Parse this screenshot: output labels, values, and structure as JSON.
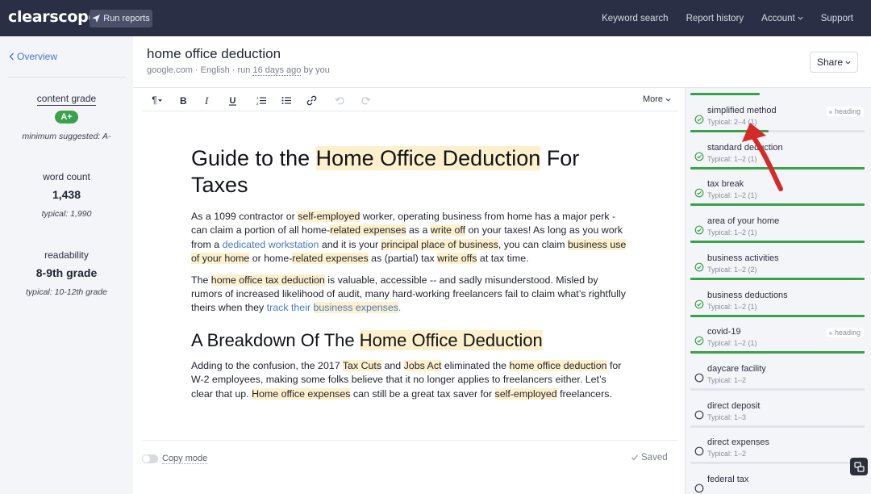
{
  "app": {
    "logo_text": "clearscope",
    "run_reports_label": "Run reports",
    "nav": [
      "Keyword search",
      "Report history",
      "Account",
      "Support"
    ]
  },
  "sidebar": {
    "overview_label": "Overview",
    "content_grade_label": "content grade",
    "content_grade_value": "A+",
    "minimum_suggested": "minimum suggested: A-",
    "word_count_label": "word count",
    "word_count_value": "1,438",
    "word_count_typical": "typical: 1,990",
    "readability_label": "readability",
    "readability_value": "8-9th grade",
    "readability_typical": "typical: 10-12th grade"
  },
  "document": {
    "title": "home office deduction",
    "meta_prefix": "google.com · English · run ",
    "meta_time": "16 days ago",
    "meta_suffix": " by you",
    "share_label": "Share"
  },
  "toolbar": {
    "paragraph_icon": "¶",
    "more_label": "More"
  },
  "editor": {
    "h1_a": "Guide to the ",
    "h1_b": "Home Office Deduction",
    "h1_c": " For Taxes",
    "p1": [
      "As a 1099 contractor or ",
      "self-employed",
      " worker, operating business from home has a major perk - can claim a portion of all home-",
      "related expenses",
      " as a ",
      "write off",
      " on your taxes! As long as you work from a ",
      "dedicated workstation",
      " and it is your ",
      "principal place of business",
      ", you can claim ",
      "business use of your home",
      " or home-",
      "related expenses",
      " as (partial) tax ",
      "write offs",
      " at tax time."
    ],
    "p2": [
      "The ",
      "home office tax deduction",
      " is valuable, accessible -- and sadly misunderstood. Misled by rumors of increased likelihood of audit, many hard-working freelancers fail to claim what’s rightfully theirs when they ",
      "track their ",
      "business expenses",
      "."
    ],
    "h2_a": "A Breakdown Of The ",
    "h2_b": "Home Office Deduction",
    "p3": [
      "Adding to the confusion, the 2017 ",
      "Tax Cuts",
      " and ",
      "Jobs Act",
      " eliminated the ",
      "home office deduction",
      " for W-2 employees, making some folks believe that it no longer applies to freelancers either. Let’s clear that up. ",
      "Home office expenses",
      " can still be a great tax saver for ",
      "self-employed",
      " freelancers."
    ]
  },
  "footer": {
    "copy_mode_label": "Copy mode",
    "saved_label": "Saved"
  },
  "terms": [
    {
      "name": "simplified method",
      "typical": "Typical: 2–4 (1)",
      "checked": true,
      "heading": "heading",
      "fill": 0.45
    },
    {
      "name": "standard deduction",
      "typical": "Typical: 1–2 (1)",
      "checked": true,
      "heading": "",
      "fill": 1.0
    },
    {
      "name": "tax break",
      "typical": "Typical: 1–2 (1)",
      "checked": true,
      "heading": "",
      "fill": 1.0
    },
    {
      "name": "area of your home",
      "typical": "Typical: 1–2 (1)",
      "checked": true,
      "heading": "",
      "fill": 1.0
    },
    {
      "name": "business activities",
      "typical": "Typical: 1–2 (2)",
      "checked": true,
      "heading": "",
      "fill": 1.0
    },
    {
      "name": "business deductions",
      "typical": "Typical: 1–2 (1)",
      "checked": true,
      "heading": "",
      "fill": 1.0
    },
    {
      "name": "covid-19",
      "typical": "Typical: 1–2 (1)",
      "checked": true,
      "heading": "heading",
      "fill": 1.0
    },
    {
      "name": "daycare facility",
      "typical": "Typical: 1–2",
      "checked": false,
      "heading": "",
      "fill": 0.0
    },
    {
      "name": "direct deposit",
      "typical": "Typical: 1–3",
      "checked": false,
      "heading": "",
      "fill": 0.0
    },
    {
      "name": "direct expenses",
      "typical": "Typical: 1–2",
      "checked": false,
      "heading": "",
      "fill": 0.0
    },
    {
      "name": "federal tax",
      "typical": "",
      "checked": false,
      "heading": "",
      "fill": 0.0
    }
  ],
  "colors": {
    "nav_bg": "#2a2f45",
    "accent_green": "#3aa24a",
    "link_blue": "#4a78c6",
    "highlight": "#fdf0cc",
    "annotation_red": "#d42a2a"
  }
}
